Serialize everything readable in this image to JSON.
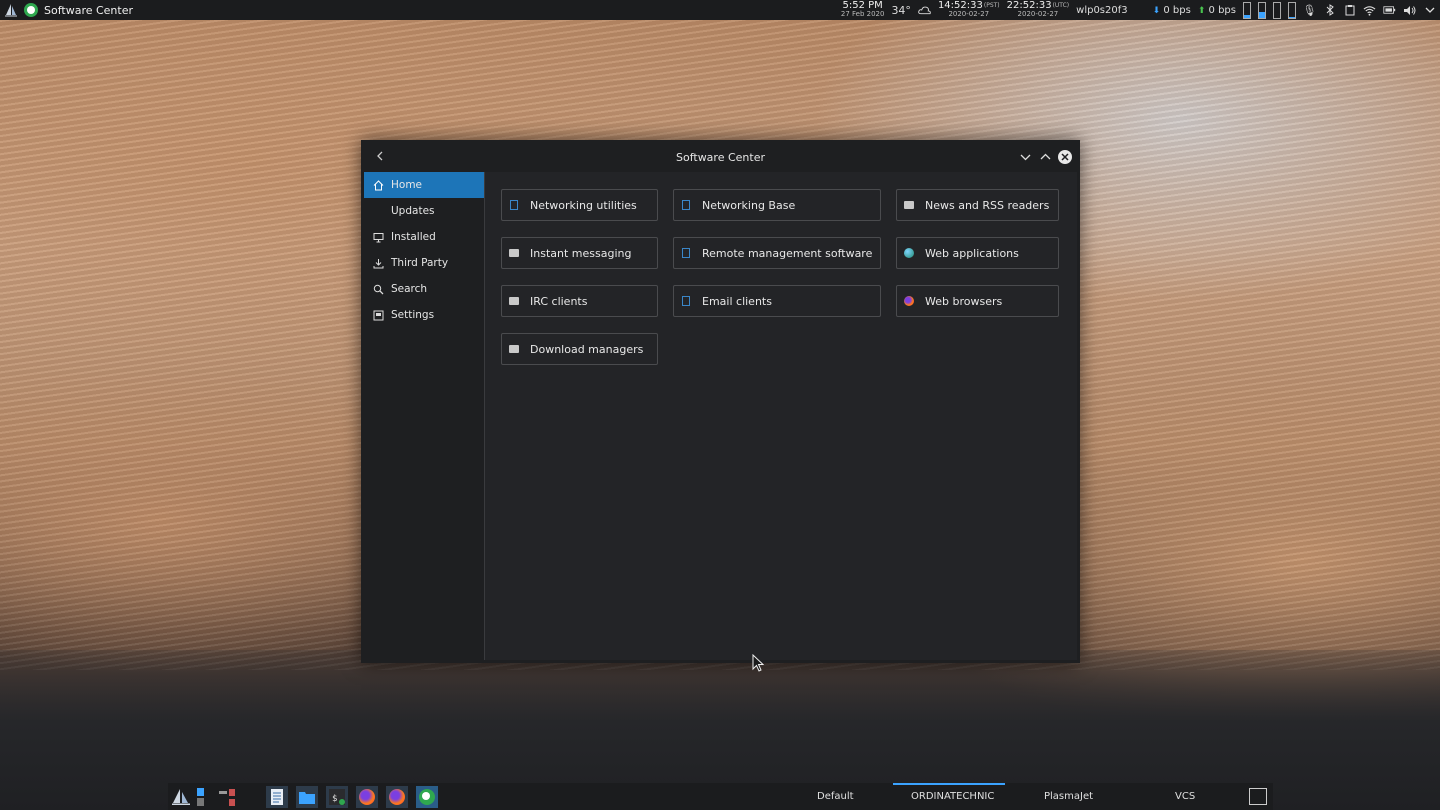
{
  "top_panel": {
    "app_title": "Software Center",
    "clock": {
      "time": "5:52 PM",
      "date": "27 Feb 2020"
    },
    "weather": {
      "temp": "34°",
      "icon": "cloud-icon"
    },
    "clock_pst": {
      "time": "14:52:33",
      "tz": "(PST)",
      "date": "2020-02-27"
    },
    "clock_utc": {
      "time": "22:52:33",
      "tz": "(UTC)",
      "date": "2020-02-27"
    },
    "network_interface": "wlp0s20f3",
    "net_down": "0 bps",
    "net_up": "0 bps"
  },
  "window": {
    "title": "Software Center",
    "sidebar": [
      {
        "label": "Home",
        "icon": "home-icon",
        "active": true
      },
      {
        "label": "Updates",
        "icon": "",
        "active": false
      },
      {
        "label": "Installed",
        "icon": "monitor-icon",
        "active": false
      },
      {
        "label": "Third Party",
        "icon": "download-icon",
        "active": false
      },
      {
        "label": "Search",
        "icon": "search-icon",
        "active": false
      },
      {
        "label": "Settings",
        "icon": "settings-icon",
        "active": false
      }
    ],
    "categories": [
      {
        "label": "Networking utilities",
        "icon": "book-icon"
      },
      {
        "label": "Networking Base",
        "icon": "book-icon"
      },
      {
        "label": "News and RSS readers",
        "icon": "screen-icon"
      },
      {
        "label": "Instant messaging",
        "icon": "screen-icon"
      },
      {
        "label": "Remote management software",
        "icon": "book-icon"
      },
      {
        "label": "Web applications",
        "icon": "globe-icon"
      },
      {
        "label": "IRC clients",
        "icon": "screen-icon"
      },
      {
        "label": "Email clients",
        "icon": "book-icon"
      },
      {
        "label": "Web browsers",
        "icon": "firefox-icon"
      },
      {
        "label": "Download managers",
        "icon": "screen-icon"
      }
    ]
  },
  "taskbar": {
    "activities": [
      {
        "label": "Default",
        "active": false
      },
      {
        "label": "ORDINATECHNIC",
        "active": true
      },
      {
        "label": "PlasmaJet",
        "active": false
      },
      {
        "label": "VCS",
        "active": false
      }
    ],
    "accent": "#3ba3ff"
  }
}
